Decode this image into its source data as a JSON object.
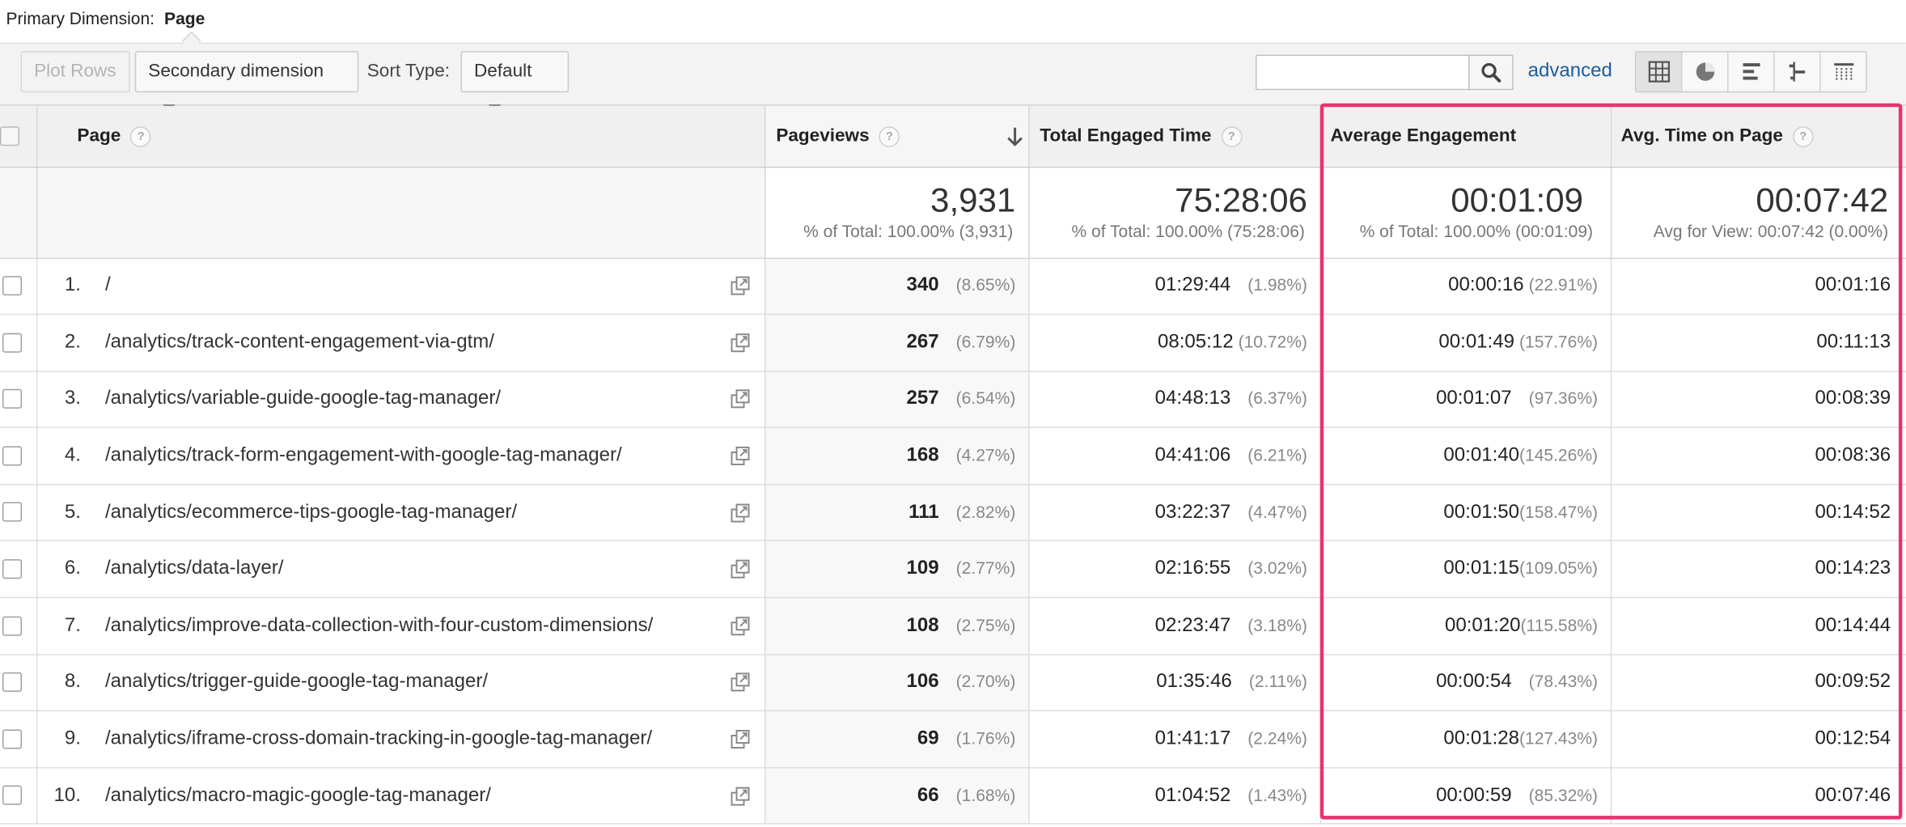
{
  "primary_dimension": {
    "label": "Primary Dimension:",
    "value": "Page"
  },
  "toolbar": {
    "plot_rows": "Plot Rows",
    "secondary_dimension": "Secondary dimension",
    "sort_type_label": "Sort Type:",
    "sort_type_value": "Default",
    "search_value": "",
    "advanced": "advanced",
    "view_icons": [
      "table-view-icon",
      "pie-view-icon",
      "performance-view-icon",
      "comparison-view-icon",
      "pivot-view-icon"
    ]
  },
  "columns": {
    "page": "Page",
    "pageviews": "Pageviews",
    "total_engaged_time": "Total Engaged Time",
    "average_engagement": "Average Engagement",
    "avg_time_on_page": "Avg. Time on Page"
  },
  "totals": {
    "pageviews": {
      "value": "3,931",
      "sub": "% of Total: 100.00% (3,931)"
    },
    "total_engaged_time": {
      "value": "75:28:06",
      "sub": "% of Total: 100.00% (75:28:06)"
    },
    "average_engagement": {
      "value": "00:01:09",
      "sub": "% of Total: 100.00% (00:01:09)"
    },
    "avg_time_on_page": {
      "value": "00:07:42",
      "sub": "Avg for View: 00:07:42 (0.00%)"
    }
  },
  "rows": [
    {
      "idx": "1.",
      "page": "/",
      "pageviews": "340",
      "pageviews_pct": "(8.65%)",
      "engaged": "01:29:44",
      "engaged_pct": "(1.98%)",
      "avg_eng": "00:00:16",
      "avg_eng_pct": "(22.91%)",
      "avg_time": "00:01:16"
    },
    {
      "idx": "2.",
      "page": "/analytics/track-content-engagement-via-gtm/",
      "pageviews": "267",
      "pageviews_pct": "(6.79%)",
      "engaged": "08:05:12",
      "engaged_pct": "(10.72%)",
      "avg_eng": "00:01:49",
      "avg_eng_pct": "(157.76%)",
      "avg_time": "00:11:13"
    },
    {
      "idx": "3.",
      "page": "/analytics/variable-guide-google-tag-manager/",
      "pageviews": "257",
      "pageviews_pct": "(6.54%)",
      "engaged": "04:48:13",
      "engaged_pct": "(6.37%)",
      "avg_eng": "00:01:07",
      "avg_eng_pct": "(97.36%)",
      "avg_time": "00:08:39"
    },
    {
      "idx": "4.",
      "page": "/analytics/track-form-engagement-with-google-tag-manager/",
      "pageviews": "168",
      "pageviews_pct": "(4.27%)",
      "engaged": "04:41:06",
      "engaged_pct": "(6.21%)",
      "avg_eng": "00:01:40",
      "avg_eng_pct": "(145.26%)",
      "avg_time": "00:08:36"
    },
    {
      "idx": "5.",
      "page": "/analytics/ecommerce-tips-google-tag-manager/",
      "pageviews": "111",
      "pageviews_pct": "(2.82%)",
      "engaged": "03:22:37",
      "engaged_pct": "(4.47%)",
      "avg_eng": "00:01:50",
      "avg_eng_pct": "(158.47%)",
      "avg_time": "00:14:52"
    },
    {
      "idx": "6.",
      "page": "/analytics/data-layer/",
      "pageviews": "109",
      "pageviews_pct": "(2.77%)",
      "engaged": "02:16:55",
      "engaged_pct": "(3.02%)",
      "avg_eng": "00:01:15",
      "avg_eng_pct": "(109.05%)",
      "avg_time": "00:14:23"
    },
    {
      "idx": "7.",
      "page": "/analytics/improve-data-collection-with-four-custom-dimensions/",
      "pageviews": "108",
      "pageviews_pct": "(2.75%)",
      "engaged": "02:23:47",
      "engaged_pct": "(3.18%)",
      "avg_eng": "00:01:20",
      "avg_eng_pct": "(115.58%)",
      "avg_time": "00:14:44"
    },
    {
      "idx": "8.",
      "page": "/analytics/trigger-guide-google-tag-manager/",
      "pageviews": "106",
      "pageviews_pct": "(2.70%)",
      "engaged": "01:35:46",
      "engaged_pct": "(2.11%)",
      "avg_eng": "00:00:54",
      "avg_eng_pct": "(78.43%)",
      "avg_time": "00:09:52"
    },
    {
      "idx": "9.",
      "page": "/analytics/iframe-cross-domain-tracking-in-google-tag-manager/",
      "pageviews": "69",
      "pageviews_pct": "(1.76%)",
      "engaged": "01:41:17",
      "engaged_pct": "(2.24%)",
      "avg_eng": "00:01:28",
      "avg_eng_pct": "(127.43%)",
      "avg_time": "00:12:54"
    },
    {
      "idx": "10.",
      "page": "/analytics/macro-magic-google-tag-manager/",
      "pageviews": "66",
      "pageviews_pct": "(1.68%)",
      "engaged": "01:04:52",
      "engaged_pct": "(1.43%)",
      "avg_eng": "00:00:59",
      "avg_eng_pct": "(85.32%)",
      "avg_time": "00:07:46"
    }
  ],
  "colors": {
    "highlight": "#e8336f",
    "link": "#1a5fa0"
  }
}
